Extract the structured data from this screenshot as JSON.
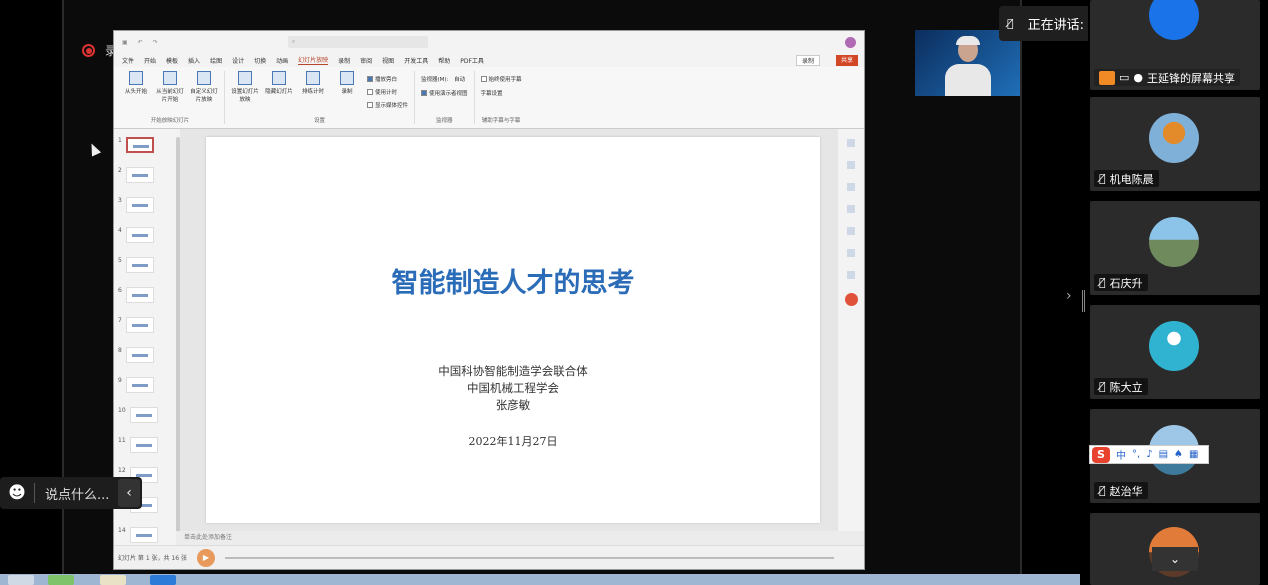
{
  "recording": {
    "label": "录制中"
  },
  "ppt": {
    "menu": [
      "文件",
      "开始",
      "模板",
      "插入",
      "绘图",
      "设计",
      "切换",
      "动画",
      "幻灯片放映",
      "录制",
      "审阅",
      "视图",
      "开发工具",
      "帮助",
      "PDF工具"
    ],
    "active_menu": "幻灯片放映",
    "record_button": "录制",
    "share_button": "共享",
    "ribbon": {
      "groups": [
        {
          "label": "开始放映幻灯片",
          "buttons": [
            "从头开始",
            "从当前幻灯片开始",
            "自定义幻灯片放映"
          ]
        },
        {
          "label": "设置",
          "buttons": [
            "设置幻灯片放映",
            "隐藏幻灯片",
            "排练计时",
            "录制"
          ]
        },
        {
          "label": "监视器",
          "buttons": [
            "监视器(M):",
            "自动",
            "使用演示者视图"
          ]
        },
        {
          "label": "辅助字幕与字幕",
          "buttons": [
            "始终使用字幕",
            "字幕设置"
          ]
        }
      ],
      "checks": [
        "播放旁白",
        "使用计时",
        "显示媒体控件"
      ]
    },
    "thumbnails": [
      "1",
      "2",
      "3",
      "4",
      "5",
      "6",
      "7",
      "8",
      "9",
      "10",
      "11",
      "12",
      "13",
      "14"
    ],
    "slide": {
      "title": "智能制造人才的思考",
      "org1": "中国科协智能制造学会联合体",
      "org2": "中国机械工程学会",
      "author": "张彦敏",
      "date": "2022年11月27日"
    },
    "notes_placeholder": "单击此处添加备注",
    "status": "幻灯片 第 1 张，共 16 张"
  },
  "speaking": {
    "label": "正在讲话:"
  },
  "chat": {
    "placeholder": "说点什么..."
  },
  "participants": [
    {
      "name": "王延锋的屏幕共享",
      "kind": "screen-share"
    },
    {
      "name": "机电陈晨",
      "avatar": "hot-air-balloon"
    },
    {
      "name": "石庆升",
      "avatar": "castle-landscape"
    },
    {
      "name": "陈大立",
      "avatar": "default-user"
    },
    {
      "name": "赵治华",
      "avatar": "mountain-lake"
    },
    {
      "name": "",
      "avatar": "sunset"
    }
  ],
  "ime": {
    "label": "中"
  },
  "colors": {
    "accent": "#2b6cb8",
    "record_red": "#dd3333",
    "share_orange": "#d24726"
  }
}
